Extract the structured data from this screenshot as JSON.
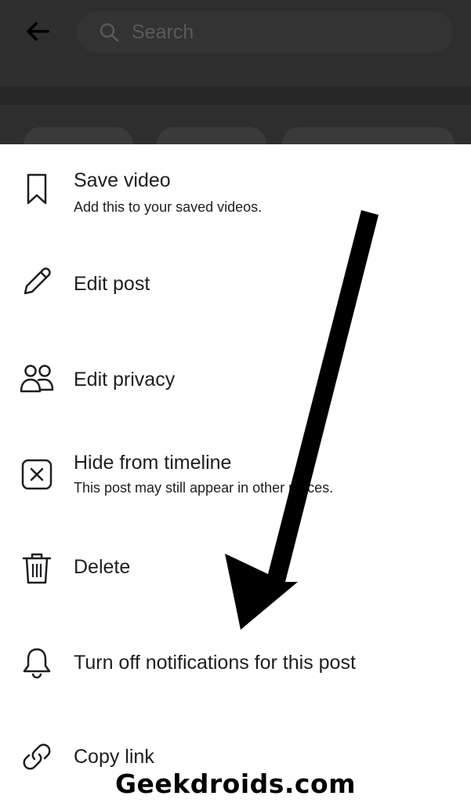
{
  "header": {
    "search_placeholder": "Search"
  },
  "menu": {
    "items": [
      {
        "title": "Save video",
        "subtitle": "Add this to your saved videos.",
        "icon": "bookmark-icon"
      },
      {
        "title": "Edit post",
        "subtitle": "",
        "icon": "pencil-icon"
      },
      {
        "title": "Edit privacy",
        "subtitle": "",
        "icon": "people-icon"
      },
      {
        "title": "Hide from timeline",
        "subtitle": "This post may still appear in other places.",
        "icon": "x-box-icon"
      },
      {
        "title": "Delete",
        "subtitle": "",
        "icon": "trash-icon"
      },
      {
        "title": "Turn off notifications for this post",
        "subtitle": "",
        "icon": "bell-icon"
      },
      {
        "title": "Copy link",
        "subtitle": "",
        "icon": "link-icon"
      }
    ]
  },
  "watermark": "Geekdroids.com",
  "colors": {
    "overlay": "#2e2e2e",
    "sheet": "#ffffff",
    "text": "#1c1e21",
    "arrow": "#000000"
  }
}
